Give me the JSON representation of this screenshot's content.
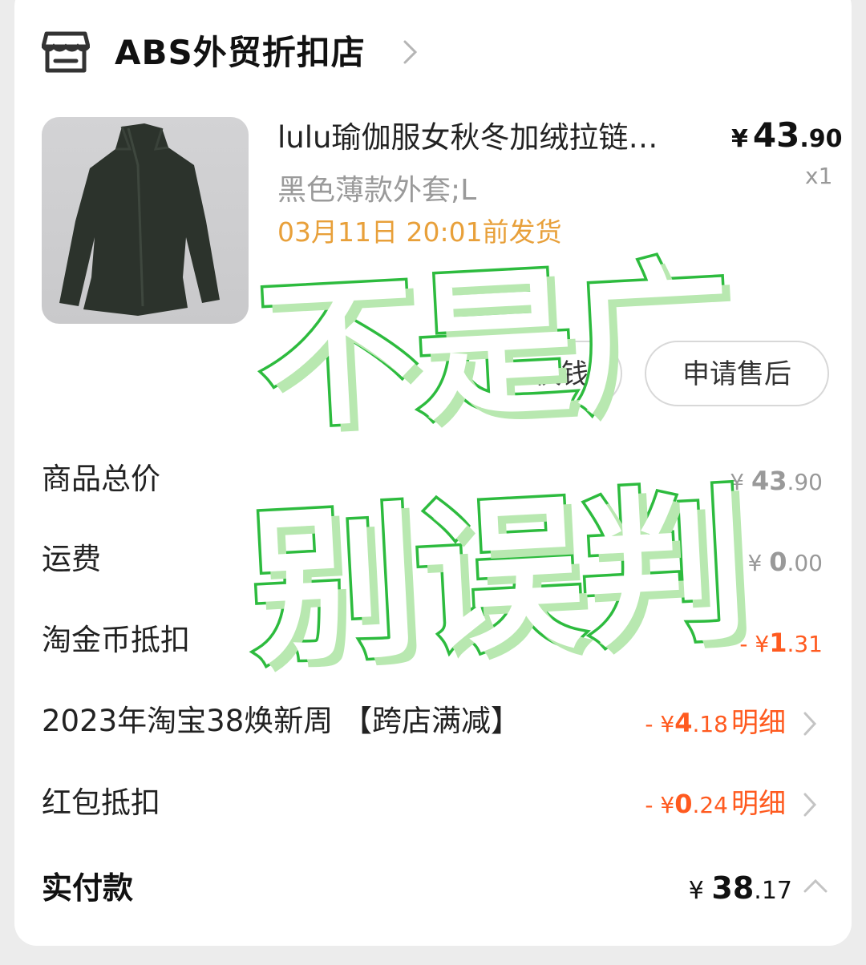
{
  "shop": {
    "name": "ABS外贸折扣店",
    "icon": "store-icon"
  },
  "item": {
    "title": "lulu瑜伽服女秋冬加绒拉链…",
    "price_currency": "¥",
    "price_int": "43",
    "price_dec": ".90",
    "quantity": "x1",
    "spec": "黑色薄款外套;L",
    "ship_note": "03月11日 20:01前发货"
  },
  "buttons": {
    "partial": "快钱",
    "after_sale": "申请售后"
  },
  "rows": [
    {
      "label": "商品总价",
      "sign": "",
      "currency": "¥",
      "int": "43",
      "dec": ".90"
    },
    {
      "label": "运费",
      "sign": "",
      "currency": "¥",
      "int": "0",
      "dec": ".00"
    },
    {
      "label": "淘金币抵扣",
      "sign": "-",
      "currency": "¥",
      "int": "1",
      "dec": ".31"
    },
    {
      "label": "2023年淘宝38焕新周 【跨店满减】",
      "sign": "-",
      "currency": "¥",
      "int": "4",
      "dec": ".18",
      "detail": "明细"
    },
    {
      "label": "红包抵扣",
      "sign": "-",
      "currency": "¥",
      "int": "0",
      "dec": ".24",
      "detail": "明细"
    }
  ],
  "total": {
    "label": "实付款",
    "currency": "¥",
    "int": "38",
    "dec": ".17"
  },
  "overlay": {
    "line1": "不是广",
    "line2": "别误判"
  },
  "colors": {
    "accent": "#ff5a1f",
    "ship": "#e8a03a",
    "overlay_stroke": "#2dbb3e"
  }
}
